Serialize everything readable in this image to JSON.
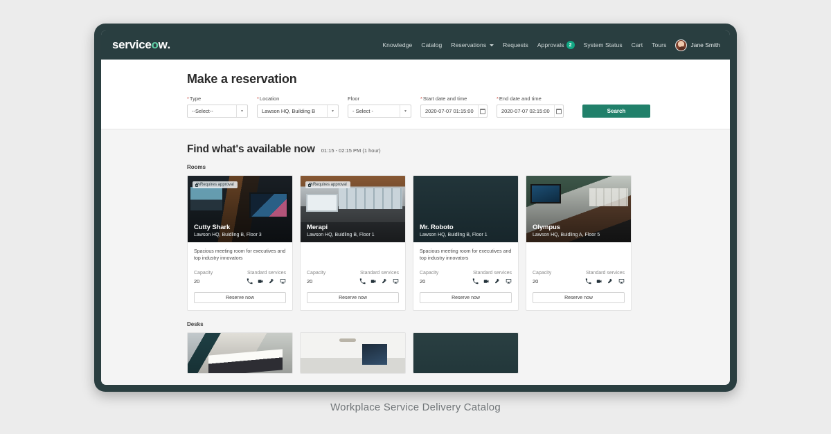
{
  "nav": {
    "brand": {
      "pre": "service",
      "accent": "n",
      "post": "w",
      "suffix": "o",
      "full": "servicenow"
    },
    "links": [
      {
        "label": "Knowledge",
        "name": "nav-knowledge"
      },
      {
        "label": "Catalog",
        "name": "nav-catalog"
      },
      {
        "label": "Reservations",
        "name": "nav-reservations",
        "caret": true
      },
      {
        "label": "Requests",
        "name": "nav-requests"
      },
      {
        "label": "Approvals",
        "name": "nav-approvals",
        "badge": "2"
      },
      {
        "label": "System Status",
        "name": "nav-system-status"
      },
      {
        "label": "Cart",
        "name": "nav-cart"
      },
      {
        "label": "Tours",
        "name": "nav-tours"
      }
    ],
    "user": "Jane Smith",
    "badge_color": "#13a884",
    "bar_color": "#293e40"
  },
  "form": {
    "title": "Make a reservation",
    "fields": [
      {
        "label": "Type",
        "required": true,
        "value": "--Select--"
      },
      {
        "label": "Location",
        "required": true,
        "value": "Lawson HQ, Building B"
      },
      {
        "label": "Floor",
        "required": false,
        "value": "- Select -"
      }
    ],
    "start": {
      "label": "Start date and time",
      "required": true,
      "value": "2020-07-07  01:15:00"
    },
    "end": {
      "label": "End date and time",
      "required": true,
      "value": "2020-07-07  02:15:00"
    },
    "search_label": "Search",
    "search_color": "#21806a"
  },
  "results": {
    "title": "Find what's available now",
    "subtitle": "01:15 - 02:15 PM (1 hour)",
    "rooms_label": "Rooms",
    "desks_label": "Desks",
    "capacity_label": "Capacity",
    "services_label": "Standard services",
    "reserve_label": "Reserve now",
    "approval_label": "Requires approval",
    "rooms": [
      {
        "name": "Cutty Shark",
        "location": "Lawson HQ, Buidling B, Floor 3",
        "description": "Spacious meeting room for executives and top industry innovators",
        "capacity": "20",
        "requires_approval": true,
        "photo": "ph-cutty"
      },
      {
        "name": "Merapi",
        "location": "Lawson HQ, Buidling B, Floor 1",
        "description": "",
        "capacity": "20",
        "requires_approval": true,
        "photo": "ph-merapi"
      },
      {
        "name": "Mr. Roboto",
        "location": "Lawson HQ, Buidling B, Floor 1",
        "description": "Spacious meeting room for executives and top industry innovators",
        "capacity": "20",
        "requires_approval": false,
        "photo": "ph-dark"
      },
      {
        "name": "Olympus",
        "location": "Lawson HQ, Buidling A, Floor 5",
        "description": "",
        "capacity": "20",
        "requires_approval": false,
        "photo": "ph-olympus"
      }
    ],
    "service_icons": [
      "phone-icon",
      "video-camera-icon",
      "projector-icon",
      "monitor-icon"
    ],
    "desks": [
      {
        "photo": "ph-desk1"
      },
      {
        "photo": "ph-desk2"
      },
      {
        "photo": "ph-desk3"
      }
    ]
  },
  "caption": "Workplace Service Delivery Catalog"
}
